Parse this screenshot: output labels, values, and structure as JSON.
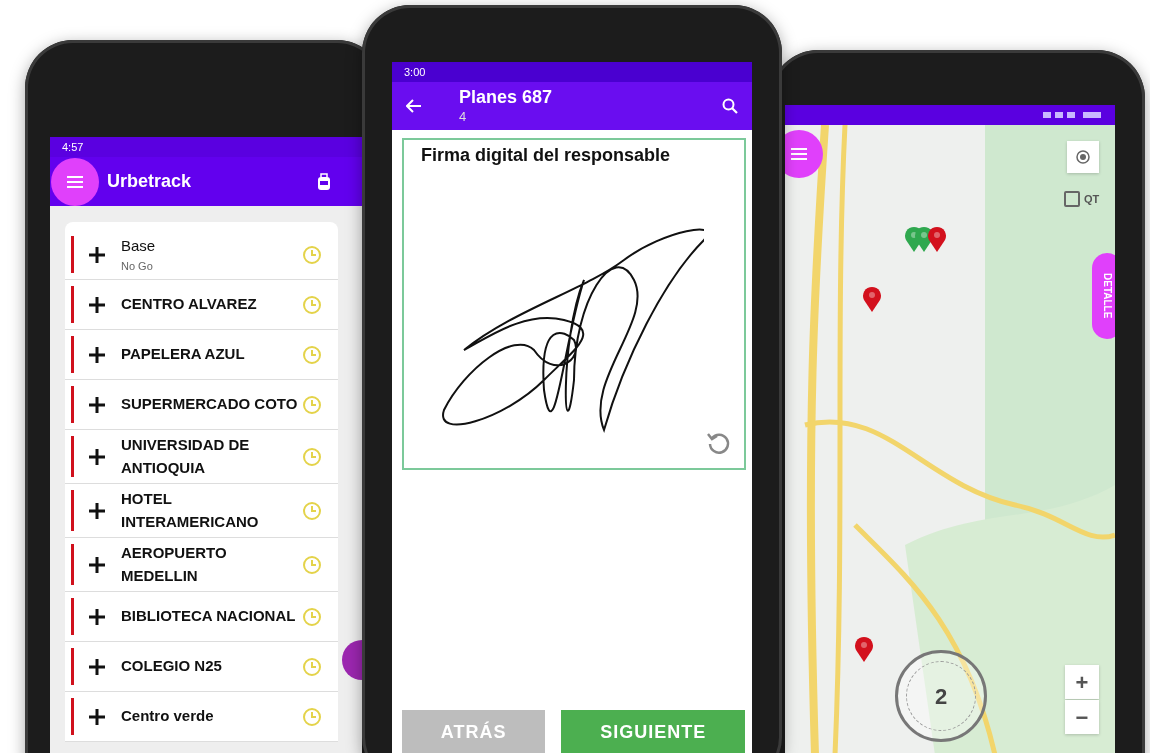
{
  "left_phone": {
    "status_time": "4:57",
    "title": "Urbetrack",
    "items": [
      {
        "name": "Base",
        "subtitle": "No Go"
      },
      {
        "name": "CENTRO ALVAREZ"
      },
      {
        "name": "PAPELERA AZUL"
      },
      {
        "name": "SUPERMERCADO COTO"
      },
      {
        "name": "UNIVERSIDAD DE ANTIOQUIA"
      },
      {
        "name": "HOTEL INTERAMERICANO"
      },
      {
        "name": "AEROPUERTO MEDELLIN"
      },
      {
        "name": "BIBLIOTECA NACIONAL"
      },
      {
        "name": "COLEGIO N25"
      },
      {
        "name": "Centro verde"
      }
    ]
  },
  "center_phone": {
    "status_time": "3:00",
    "title": "Planes 687",
    "subtitle": "4",
    "signature_label": "Firma digital del responsable",
    "buttons": [
      {
        "label": "ATRÁS",
        "disabled": true
      },
      {
        "label": "SIGUIENTE",
        "disabled": false
      }
    ]
  },
  "right_phone": {
    "qt_checkbox": {
      "label": "QT",
      "checked": false
    },
    "details_tab": "DETALLE",
    "counter": "2",
    "zoom_in": "+",
    "zoom_out": "−",
    "markers": [
      {
        "color": "#2fa84f"
      },
      {
        "color": "#2fa84f"
      },
      {
        "color": "#d3111d"
      },
      {
        "color": "#d3111d"
      },
      {
        "color": "#d3111d"
      }
    ]
  }
}
